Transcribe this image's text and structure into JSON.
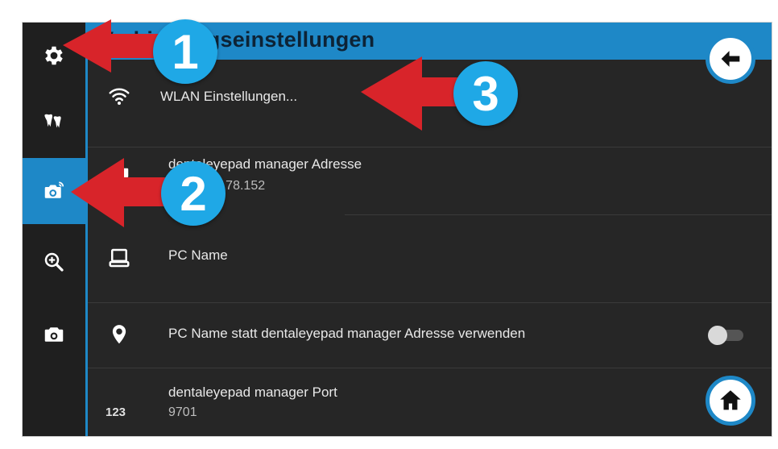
{
  "header": {
    "title": "Verbindungseinstellungen"
  },
  "sidebar": {
    "items": [
      {
        "icon": "gear-icon"
      },
      {
        "icon": "teeth-icon"
      },
      {
        "icon": "camera-wifi-icon",
        "active": true
      },
      {
        "icon": "zoom-in-icon"
      },
      {
        "icon": "camera-icon"
      }
    ]
  },
  "settings": {
    "wlan": {
      "label": "WLAN Einstellungen...",
      "icon": "wifi-icon"
    },
    "manager_address": {
      "label": "dentaleyepad manager Adresse",
      "value": "192.168.178.152",
      "icon": "network-card-icon"
    },
    "pc_name": {
      "label": "PC Name",
      "icon": "computer-icon"
    },
    "use_pc_name": {
      "label": "PC Name statt dentaleyepad manager Adresse verwenden",
      "icon": "location-pin-icon",
      "enabled": false
    },
    "manager_port": {
      "label": "dentaleyepad manager Port",
      "value": "9701",
      "icon_text": "123"
    }
  },
  "annotations": {
    "badge1": "1",
    "badge2": "2",
    "badge3": "3"
  },
  "colors": {
    "accent": "#1e88c7",
    "background": "#262626",
    "sidebar": "#1f1f1f",
    "arrow": "#d8242a",
    "badge": "#1fa8e6"
  }
}
